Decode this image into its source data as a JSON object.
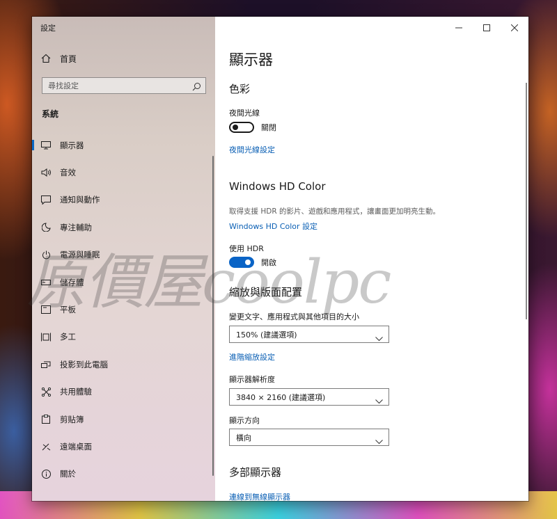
{
  "window": {
    "title": "設定",
    "controls": {
      "minimize": "minimize-icon",
      "maximize": "maximize-icon",
      "close": "close-icon"
    }
  },
  "sidebar": {
    "home_label": "首頁",
    "search_placeholder": "尋找設定",
    "section_label": "系統",
    "items": [
      {
        "label": "顯示器",
        "icon": "monitor-icon",
        "active": true
      },
      {
        "label": "音效",
        "icon": "speaker-icon"
      },
      {
        "label": "通知與動作",
        "icon": "notification-icon"
      },
      {
        "label": "專注輔助",
        "icon": "moon-icon"
      },
      {
        "label": "電源與睡眠",
        "icon": "power-icon"
      },
      {
        "label": "儲存體",
        "icon": "storage-icon"
      },
      {
        "label": "平板",
        "icon": "tablet-icon"
      },
      {
        "label": "多工",
        "icon": "multitask-icon"
      },
      {
        "label": "投影到此電腦",
        "icon": "projection-icon"
      },
      {
        "label": "共用體驗",
        "icon": "shared-experience-icon"
      },
      {
        "label": "剪貼簿",
        "icon": "clipboard-icon"
      },
      {
        "label": "遠端桌面",
        "icon": "remote-desktop-icon"
      },
      {
        "label": "關於",
        "icon": "info-icon"
      }
    ]
  },
  "main": {
    "page_title": "顯示器",
    "color": {
      "heading": "色彩",
      "night_light_label": "夜間光線",
      "night_light_state": "關閉",
      "night_light_settings_link": "夜間光線設定"
    },
    "hdr": {
      "heading": "Windows HD Color",
      "description": "取得支援 HDR 的影片、遊戲和應用程式，讓畫面更加明亮生動。",
      "settings_link": "Windows HD Color 設定",
      "use_hdr_label": "使用 HDR",
      "use_hdr_state": "開啟"
    },
    "scale": {
      "heading": "縮放與版面配置",
      "size_label": "變更文字、應用程式與其他項目的大小",
      "size_value": "150% (建議選項)",
      "advanced_link": "進階縮放設定",
      "resolution_label": "顯示器解析度",
      "resolution_value": "3840 × 2160 (建議選項)",
      "orientation_label": "顯示方向",
      "orientation_value": "橫向"
    },
    "multi": {
      "heading": "多部顯示器",
      "connect_link": "連線到無線顯示器"
    }
  },
  "watermark": {
    "text": "原價屋coolpc"
  },
  "colors": {
    "accent": "#0a64c6",
    "link": "#0a5fb4"
  }
}
